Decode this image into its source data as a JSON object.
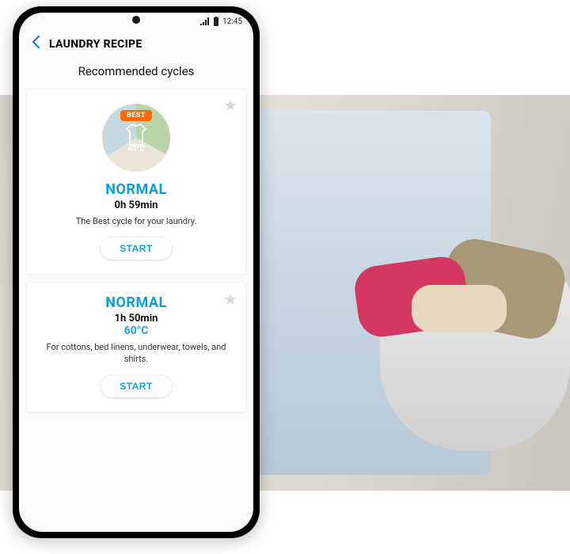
{
  "statusbar": {
    "time": "12:45"
  },
  "header": {
    "title": "LAUNDRY RECIPE"
  },
  "section": {
    "heading": "Recommended cycles"
  },
  "cycles": [
    {
      "badge": "BEST",
      "thumb_temp": "40°C",
      "name": "NORMAL",
      "duration": "0h 59min",
      "temp": "",
      "desc": "The Best cycle for your laundry.",
      "cta": "START"
    },
    {
      "badge": "",
      "thumb_temp": "",
      "name": "NORMAL",
      "duration": "1h 50min",
      "temp": "60°C",
      "desc": "For cottons, bed linens, underwear, towels, and shirts.",
      "cta": "START"
    }
  ],
  "colors": {
    "accent": "#0d9fd9",
    "best_badge": "#ff6a00"
  }
}
